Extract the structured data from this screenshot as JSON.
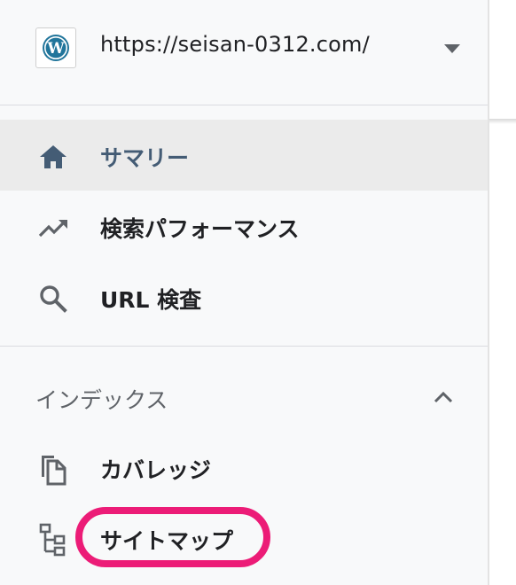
{
  "property": {
    "url": "https://seisan-0312.com/",
    "logo_icon": "wordpress-icon",
    "dropdown_icon": "caret-down-icon"
  },
  "nav": [
    {
      "label": "サマリー",
      "icon": "home-icon",
      "active": true
    },
    {
      "label": "検索パフォーマンス",
      "icon": "trending-up-icon",
      "active": false
    },
    {
      "label": "URL 検査",
      "icon": "search-icon",
      "active": false
    }
  ],
  "index_section": {
    "label": "インデックス",
    "toggle_icon": "chevron-up-icon",
    "items": [
      {
        "label": "カバレッジ",
        "icon": "copy-icon"
      },
      {
        "label": "サイトマップ",
        "icon": "sitemap-icon",
        "highlighted": true
      }
    ]
  },
  "colors": {
    "active_text": "#445c75",
    "highlight_ring": "#ec1c77",
    "wordpress_blue": "#21759b"
  }
}
